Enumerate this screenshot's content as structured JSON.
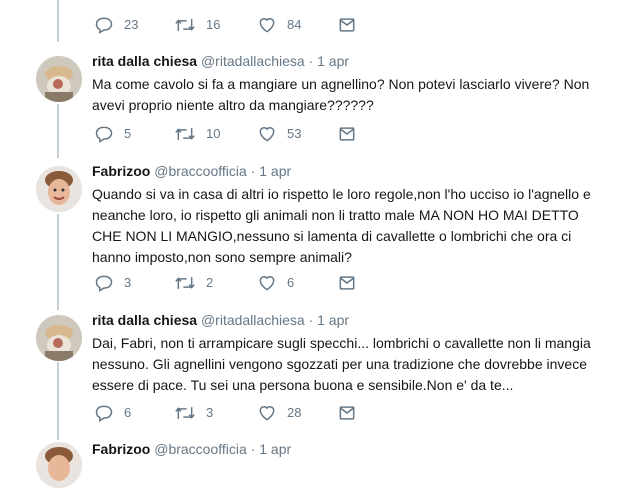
{
  "icons": {
    "reply": "reply-icon",
    "retweet": "retweet-icon",
    "like": "heart-icon",
    "dm": "envelope-icon"
  },
  "top_actions": {
    "replies": "23",
    "retweets": "16",
    "likes": "84"
  },
  "tweets": [
    {
      "name": "rita dalla chiesa",
      "handle": "@ritadallachiesa",
      "sep": " · ",
      "date": "1 apr",
      "lines": [
        "Ma come cavolo si fa a mangiare un agnellino? Non potevi lasciarlo vivere? Non",
        "avevi proprio niente altro da mangiare??????"
      ],
      "replies": "5",
      "retweets": "10",
      "likes": "53"
    },
    {
      "name": "Fabrizoo",
      "handle": "@braccoofficia",
      "sep": " · ",
      "date": "1 apr",
      "lines": [
        "Quando si va in casa di altri io rispetto le loro regole,non l'ho ucciso io l'agnello e",
        "neanche loro, io rispetto gli animali non li tratto male MA NON HO MAI DETTO",
        "CHE NON LI MANGIO,nessuno si lamenta di cavallette o lombrichi che ora ci",
        "hanno imposto,non sono sempre animali?"
      ],
      "replies": "3",
      "retweets": "2",
      "likes": "6"
    },
    {
      "name": "rita dalla chiesa",
      "handle": "@ritadallachiesa",
      "sep": " · ",
      "date": "1 apr",
      "lines": [
        "Dai, Fabri, non ti arrampicare sugli specchi... lombrichi o cavallette non li mangia",
        "nessuno. Gli agnellini vengono sgozzati per una tradizione che dovrebbe invece",
        "essere di pace. Tu sei una persona buona e sensibile.Non e' da te..."
      ],
      "replies": "6",
      "retweets": "3",
      "likes": "28"
    },
    {
      "name": "Fabrizoo",
      "handle": "@braccoofficia",
      "sep": " · ",
      "date": "1 apr"
    }
  ]
}
